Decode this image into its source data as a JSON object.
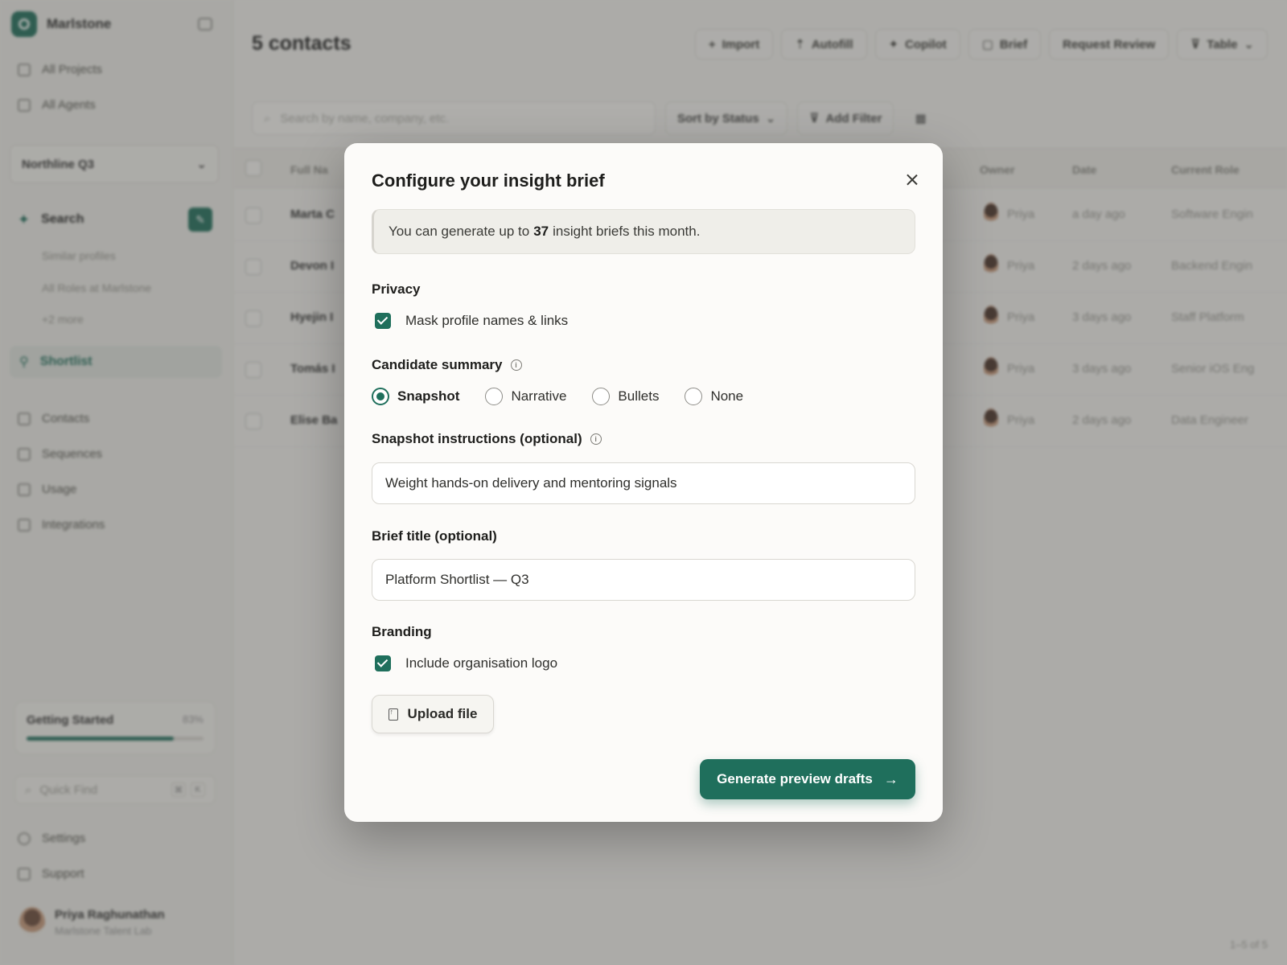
{
  "app": {
    "brand": "Marlstone",
    "nav_top": [
      "All Projects",
      "All Agents"
    ],
    "project": "Northline Q3",
    "search_label": "Search",
    "sub_links": [
      "Similar profiles",
      "All Roles at Marlstone",
      "+2 more"
    ],
    "shortlist": "Shortlist",
    "nav_bottom": [
      "Contacts",
      "Sequences",
      "Usage",
      "Integrations"
    ],
    "getting_started": {
      "label": "Getting Started",
      "pct": "83%",
      "progress": 0.83
    },
    "quick_find": "Quick Find",
    "kbd": [
      "⌘",
      "K"
    ],
    "settings": "Settings",
    "support": "Support",
    "user": {
      "name": "Priya Raghunathan",
      "org": "Marlstone Talent Lab"
    }
  },
  "main": {
    "title": "5 contacts",
    "toolbar": [
      "Import",
      "Autofill",
      "Copilot",
      "Brief",
      "Request Review",
      "Table"
    ],
    "search_placeholder": "Search by name, company, etc.",
    "sort": "Sort by Status",
    "add_filter": "Add Filter",
    "headers": {
      "name": "Full Na",
      "owner": "Owner",
      "date": "Date",
      "role": "Current Role"
    },
    "rows": [
      {
        "name": "Marta C",
        "owner": "Priya",
        "date": "a day ago",
        "role": "Software Engin"
      },
      {
        "name": "Devon I",
        "owner": "Priya",
        "date": "2 days ago",
        "role": "Backend Engin"
      },
      {
        "name": "Hyejin I",
        "owner": "Priya",
        "date": "3 days ago",
        "role": "Staff Platform"
      },
      {
        "name": "Tomás I",
        "owner": "Priya",
        "date": "3 days ago",
        "role": "Senior iOS Eng"
      },
      {
        "name": "Elise Ba",
        "owner": "Priya",
        "date": "2 days ago",
        "role": "Data Engineer"
      }
    ],
    "pager": "1–5 of 5"
  },
  "modal": {
    "title": "Configure your insight brief",
    "quota": {
      "prefix": "You can generate up to",
      "count": "37",
      "suffix": "insight briefs this month."
    },
    "privacy": {
      "label": "Privacy",
      "mask_label": "Mask profile names & links",
      "checked": true
    },
    "summary": {
      "label": "Candidate summary",
      "options": [
        "Snapshot",
        "Narrative",
        "Bullets",
        "None"
      ],
      "selected": "Snapshot"
    },
    "instructions": {
      "label": "Snapshot instructions (optional)",
      "value": "Weight hands-on delivery and mentoring signals"
    },
    "brief_title": {
      "label": "Brief title (optional)",
      "value": "Platform Shortlist — Q3"
    },
    "branding": {
      "label": "Branding",
      "logo_label": "Include organisation logo",
      "checked": true
    },
    "upload_label": "Upload file",
    "generate_label": "Generate preview drafts"
  },
  "colors": {
    "accent": "#1f6f5c"
  }
}
